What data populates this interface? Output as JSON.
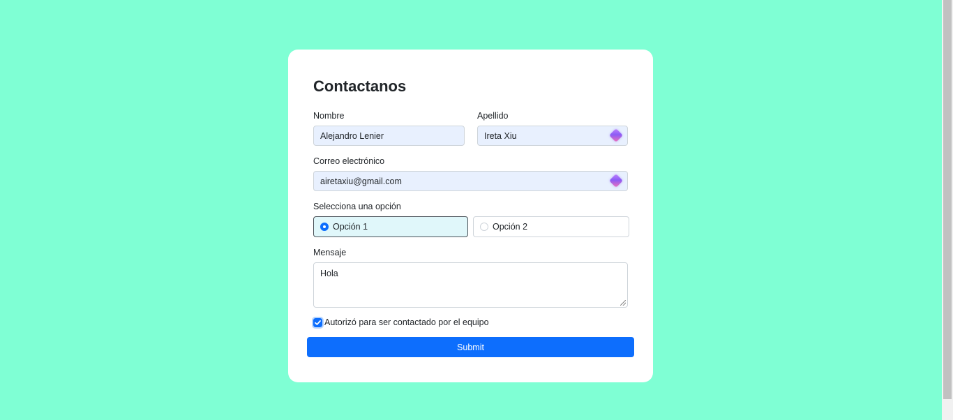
{
  "form": {
    "title": "Contactanos",
    "first_name": {
      "label": "Nombre",
      "value": "Alejandro Lenier"
    },
    "last_name": {
      "label": "Apellido",
      "value": "Ireta Xiu"
    },
    "email": {
      "label": "Correo electrónico",
      "value": "airetaxiu@gmail.com"
    },
    "option_group": {
      "label": "Selecciona una opción",
      "options": [
        {
          "label": "Opción 1",
          "selected": true
        },
        {
          "label": "Opción 2",
          "selected": false
        }
      ]
    },
    "message": {
      "label": "Mensaje",
      "value": "Hola"
    },
    "consent": {
      "label": "Autorizó para ser contactado por el equipo",
      "checked": true
    },
    "submit_label": "Submit"
  },
  "icons": {
    "autofill": "ai-sparkle-icon",
    "checkmark": "checkmark-icon"
  },
  "colors": {
    "background": "#7fffd4",
    "card": "#ffffff",
    "primary": "#0d6efd",
    "autofill_bg": "#e8f0fe",
    "selected_option_bg": "#e0f7fa"
  }
}
